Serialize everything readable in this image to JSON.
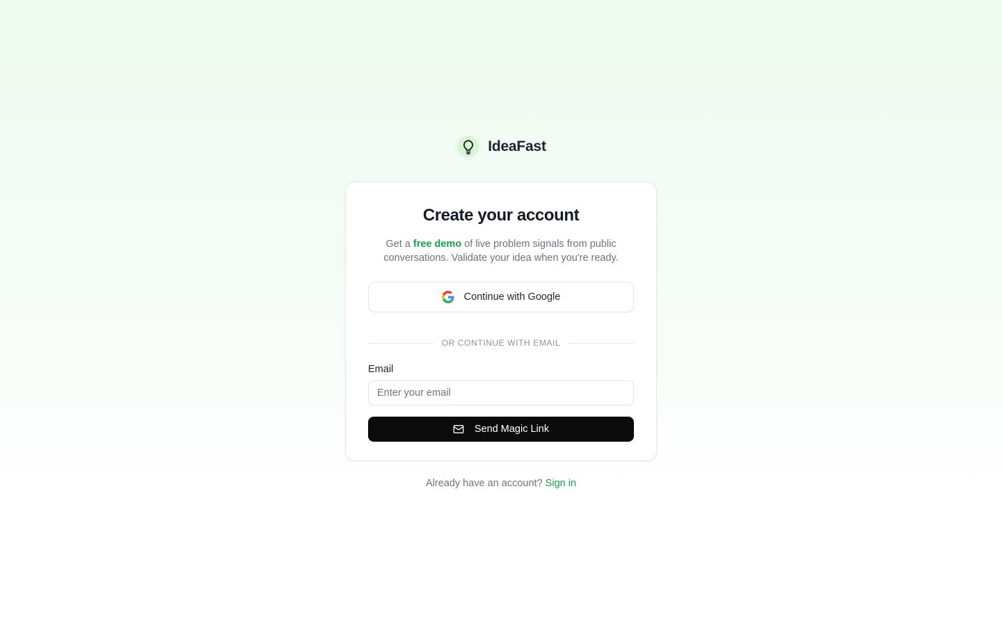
{
  "brand": {
    "name": "IdeaFast",
    "logo_icon": "lightbulb-icon"
  },
  "card": {
    "title": "Create your account",
    "subtitle_pre": "Get a ",
    "subtitle_highlight": "free demo",
    "subtitle_post": " of live problem signals from public conversations. Validate your idea when you're ready.",
    "google_button_label": "Continue with Google",
    "divider_text": "OR CONTINUE WITH EMAIL",
    "email_label": "Email",
    "email_placeholder": "Enter your email",
    "email_value": "",
    "magic_button_label": "Send Magic Link"
  },
  "footer": {
    "prompt": "Already have an account? ",
    "link_label": "Sign in"
  },
  "colors": {
    "accent": "#16a34a",
    "primary_button": "#0b0b0c",
    "logo_bg": "#d9f6d3"
  }
}
